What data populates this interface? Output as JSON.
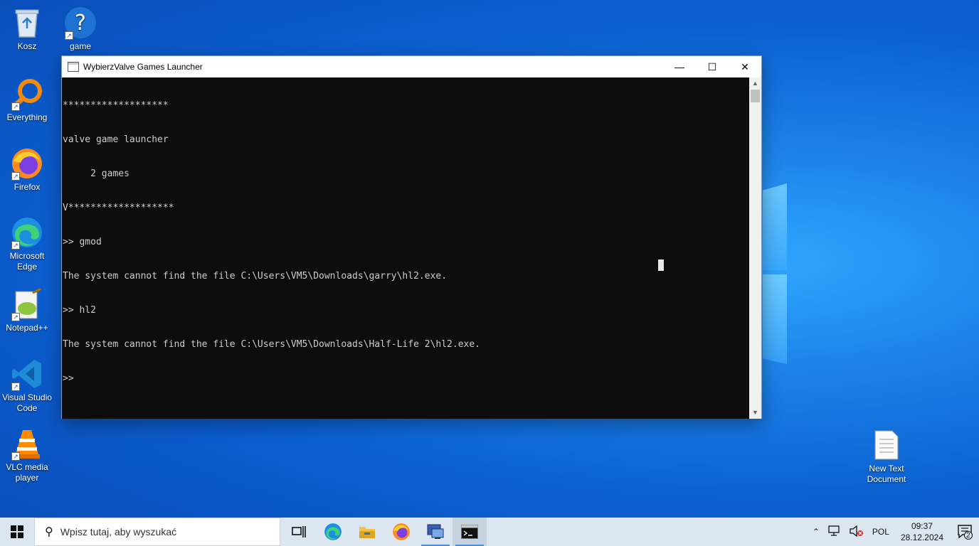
{
  "desktop": {
    "icons": [
      {
        "label": "Kosz"
      },
      {
        "label": "game"
      },
      {
        "label": "Everything"
      },
      {
        "label": "Firefox"
      },
      {
        "label": "Microsoft Edge"
      },
      {
        "label": "Notepad++"
      },
      {
        "label": "Visual Studio Code"
      },
      {
        "label": "VLC media player"
      },
      {
        "label": "New Text Document"
      }
    ]
  },
  "window": {
    "title": "WybierzValve Games Launcher",
    "controls": {
      "minimize": "—",
      "maximize": "☐",
      "close": "✕"
    },
    "console_lines": [
      "*******************",
      "valve game launcher",
      "     2 games",
      "V*******************",
      ">> gmod",
      "The system cannot find the file C:\\Users\\VM5\\Downloads\\garry\\hl2.exe.",
      ">> hl2",
      "The system cannot find the file C:\\Users\\VM5\\Downloads\\Half-Life 2\\hl2.exe.",
      ">>"
    ]
  },
  "taskbar": {
    "search_placeholder": "Wpisz tutaj, aby wyszukać",
    "language": "POL",
    "time": "09:37",
    "date": "28.12.2024",
    "notification_count": "2"
  },
  "colors": {
    "console_bg": "#0c0c0c",
    "console_fg": "#cccccc",
    "taskbar_bg": "#dbe6f1"
  }
}
